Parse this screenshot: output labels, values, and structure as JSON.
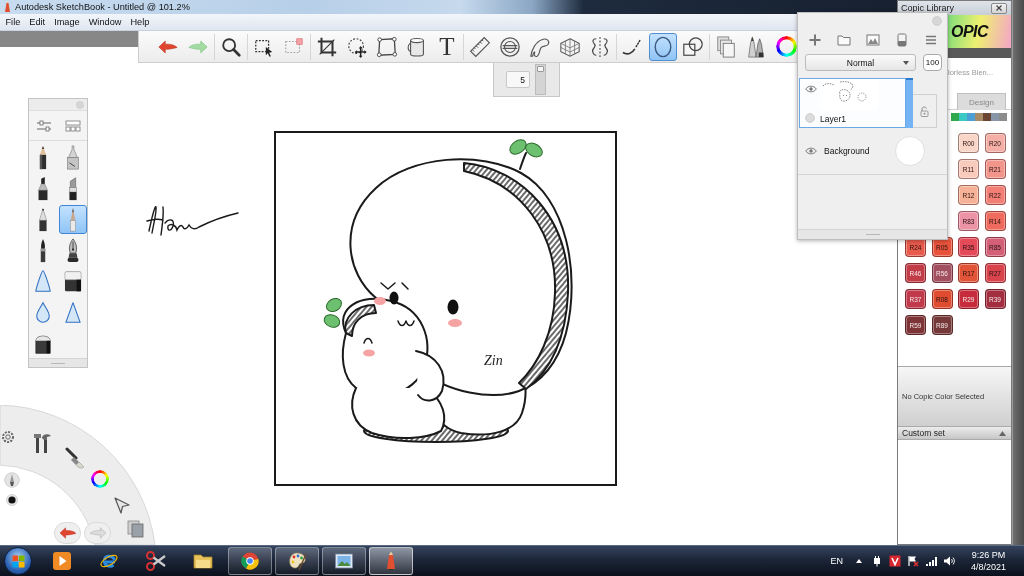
{
  "window": {
    "title": "Autodesk SketchBook - Untitled @ 101.2%"
  },
  "menu": [
    "File",
    "Edit",
    "Image",
    "Window",
    "Help"
  ],
  "toolbar": {
    "groups": [
      [
        {
          "kind": "undo",
          "selected": false
        },
        {
          "kind": "redo",
          "selected": false
        }
      ],
      [
        {
          "kind": "zoom",
          "selected": false
        }
      ],
      [
        {
          "kind": "select",
          "selected": false
        },
        {
          "kind": "select_clear",
          "selected": false
        }
      ],
      [
        {
          "kind": "crop",
          "selected": false
        },
        {
          "kind": "transform",
          "selected": false
        },
        {
          "kind": "distort",
          "selected": false
        },
        {
          "kind": "fill",
          "selected": false
        },
        {
          "kind": "text",
          "glyph": "T",
          "selected": false
        }
      ],
      [
        {
          "kind": "ruler",
          "selected": false
        },
        {
          "kind": "ellipse_guide",
          "selected": false
        },
        {
          "kind": "french_curve",
          "selected": false
        },
        {
          "kind": "perspective",
          "selected": false
        },
        {
          "kind": "symmetry",
          "selected": false
        }
      ],
      [
        {
          "kind": "stroke",
          "selected": false
        },
        {
          "kind": "ellipse",
          "selected": true
        },
        {
          "kind": "shapes",
          "selected": false
        }
      ],
      [
        {
          "kind": "copy",
          "selected": false
        },
        {
          "kind": "brushes",
          "selected": false
        },
        {
          "kind": "color",
          "selected": false
        }
      ]
    ]
  },
  "brush_size": {
    "value": "5"
  },
  "brush_palette": {
    "brushes": [
      {
        "kind": "pencil",
        "selected": false
      },
      {
        "kind": "technical_pen",
        "selected": false
      },
      {
        "kind": "marker",
        "selected": false
      },
      {
        "kind": "chisel_marker",
        "selected": false
      },
      {
        "kind": "ballpoint",
        "selected": false
      },
      {
        "kind": "felt_pen",
        "selected": true
      },
      {
        "kind": "brush_pen",
        "selected": false
      },
      {
        "kind": "fountain_pen",
        "selected": false
      },
      {
        "kind": "airbrush",
        "selected": false
      },
      {
        "kind": "hard_eraser",
        "selected": false
      },
      {
        "kind": "blur",
        "selected": false
      },
      {
        "kind": "soft_airbrush",
        "selected": false
      },
      {
        "kind": "soft_eraser",
        "selected": false
      }
    ]
  },
  "artwork": {
    "signature": "Zin"
  },
  "layers": {
    "blend_mode": "Normal",
    "opacity": "100",
    "items": [
      {
        "name": "Layer1",
        "kind": "drawing",
        "selected": true,
        "visible": true,
        "level": 1
      },
      {
        "name": "Background",
        "kind": "background",
        "selected": false,
        "visible": true
      }
    ]
  },
  "copic_library": {
    "title": "Copic Library",
    "logo": "OPIC",
    "set_name": "lorless Blen...",
    "tabs": [
      {
        "label": "Design",
        "selected": false
      }
    ],
    "families": [
      {
        "color": "#2ea84a"
      },
      {
        "color": "#3cc8c4"
      },
      {
        "color": "#4c9fd4"
      },
      {
        "color": "#a88a64"
      },
      {
        "color": "#6b4434"
      },
      {
        "color": "#8797a8"
      },
      {
        "color": "#8c8c8c"
      }
    ],
    "swatches": [
      {
        "code": "R00",
        "color": "#f8d5c6"
      },
      {
        "code": "R20",
        "color": "#f4b0a6"
      },
      {
        "code": "R11",
        "color": "#f9cbbd"
      },
      {
        "code": "R21",
        "color": "#f2968c"
      },
      {
        "code": "R12",
        "color": "#f6b296"
      },
      {
        "code": "R22",
        "color": "#f27f76"
      },
      {
        "code": "R83",
        "color": "#ec93a6"
      },
      {
        "code": "R14",
        "color": "#ef6b5e"
      },
      {
        "code": "R24",
        "color": "#e85a4c"
      },
      {
        "code": "R05",
        "color": "#e9533c"
      },
      {
        "code": "R35",
        "color": "#e44a58"
      },
      {
        "code": "R85",
        "color": "#d46078"
      },
      {
        "code": "R46",
        "color": "#c23c48"
      },
      {
        "code": "R56",
        "color": "#a24f60"
      },
      {
        "code": "R17",
        "color": "#e25438"
      },
      {
        "code": "R27",
        "color": "#d8434c"
      },
      {
        "code": "R37",
        "color": "#c03a4c"
      },
      {
        "code": "R08",
        "color": "#df4c30"
      },
      {
        "code": "R29",
        "color": "#c62c3c"
      },
      {
        "code": "R39",
        "color": "#a22e40"
      },
      {
        "code": "R59",
        "color": "#7c3436"
      },
      {
        "code": "R89",
        "color": "#76393a"
      }
    ],
    "status": "No Copic Color Selected",
    "custom_set": "Custom set"
  },
  "taskbar": {
    "apps": [
      {
        "kind": "media_player",
        "running": false,
        "selected": false
      },
      {
        "kind": "ie",
        "running": false,
        "selected": false
      },
      {
        "kind": "snipping",
        "running": false,
        "selected": false
      },
      {
        "kind": "explorer",
        "running": false,
        "selected": false
      },
      {
        "kind": "chrome",
        "running": true,
        "selected": false
      },
      {
        "kind": "paint",
        "running": true,
        "selected": false
      },
      {
        "kind": "photos",
        "running": true,
        "selected": false
      },
      {
        "kind": "sketchbook",
        "running": true,
        "selected": true
      }
    ],
    "language": "EN",
    "time": "9:26 PM",
    "date": "4/8/2021"
  }
}
